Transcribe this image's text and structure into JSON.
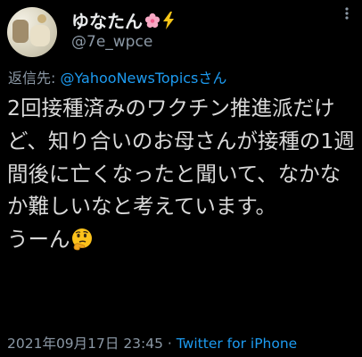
{
  "user": {
    "display_name": "ゆなたん",
    "handle": "@7e_wpce",
    "name_icons": [
      "cherry-blossom-icon",
      "lightning-icon"
    ]
  },
  "reply": {
    "prefix": "返信先: ",
    "target": "@YahooNewsTopicsさん"
  },
  "tweet": {
    "text": "2回接種済みのワクチン推進派だけど、知り合いのお母さんが接種の1週間後に亡くなったと聞いて、なかなか難しいなと考えています。\nうーん",
    "emoji": "thinking-face-icon"
  },
  "meta": {
    "timestamp": "2021年09月17日 23:45",
    "separator": " · ",
    "source": "Twitter for iPhone"
  },
  "colors": {
    "background": "#000000",
    "link": "#1d9bf0",
    "secondary": "#8b98a5"
  }
}
